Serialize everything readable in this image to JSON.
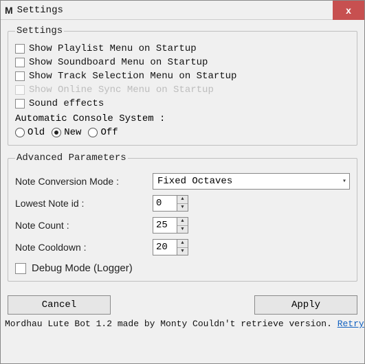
{
  "window": {
    "title": "Settings",
    "app_icon": "M",
    "close_glyph": "x"
  },
  "settings_group": {
    "legend": "Settings",
    "checks": [
      {
        "label": "Show Playlist Menu on Startup",
        "checked": false,
        "disabled": false
      },
      {
        "label": "Show Soundboard Menu on Startup",
        "checked": false,
        "disabled": false
      },
      {
        "label": "Show Track Selection Menu on Startup",
        "checked": false,
        "disabled": false
      },
      {
        "label": "Show Online Sync Menu on Startup",
        "checked": false,
        "disabled": true
      },
      {
        "label": "Sound effects",
        "checked": false,
        "disabled": false
      }
    ],
    "acs_label": "Automatic Console System :",
    "radios": [
      {
        "label": "Old",
        "checked": false
      },
      {
        "label": "New",
        "checked": true
      },
      {
        "label": "Off",
        "checked": false
      }
    ]
  },
  "advanced_group": {
    "legend": "Advanced Parameters",
    "note_conv_label": "Note Conversion Mode :",
    "note_conv_value": "Fixed Octaves",
    "lowest_label": "Lowest Note id :",
    "lowest_value": "0",
    "count_label": "Note Count :",
    "count_value": "25",
    "cooldown_label": "Note Cooldown :",
    "cooldown_value": "20",
    "debug_label": "Debug Mode (Logger)",
    "debug_checked": false
  },
  "buttons": {
    "cancel": "Cancel",
    "apply": "Apply"
  },
  "status": {
    "text": "Mordhau Lute Bot 1.2 made by Monty  Couldn't retrieve version. ",
    "retry": "Retry"
  }
}
